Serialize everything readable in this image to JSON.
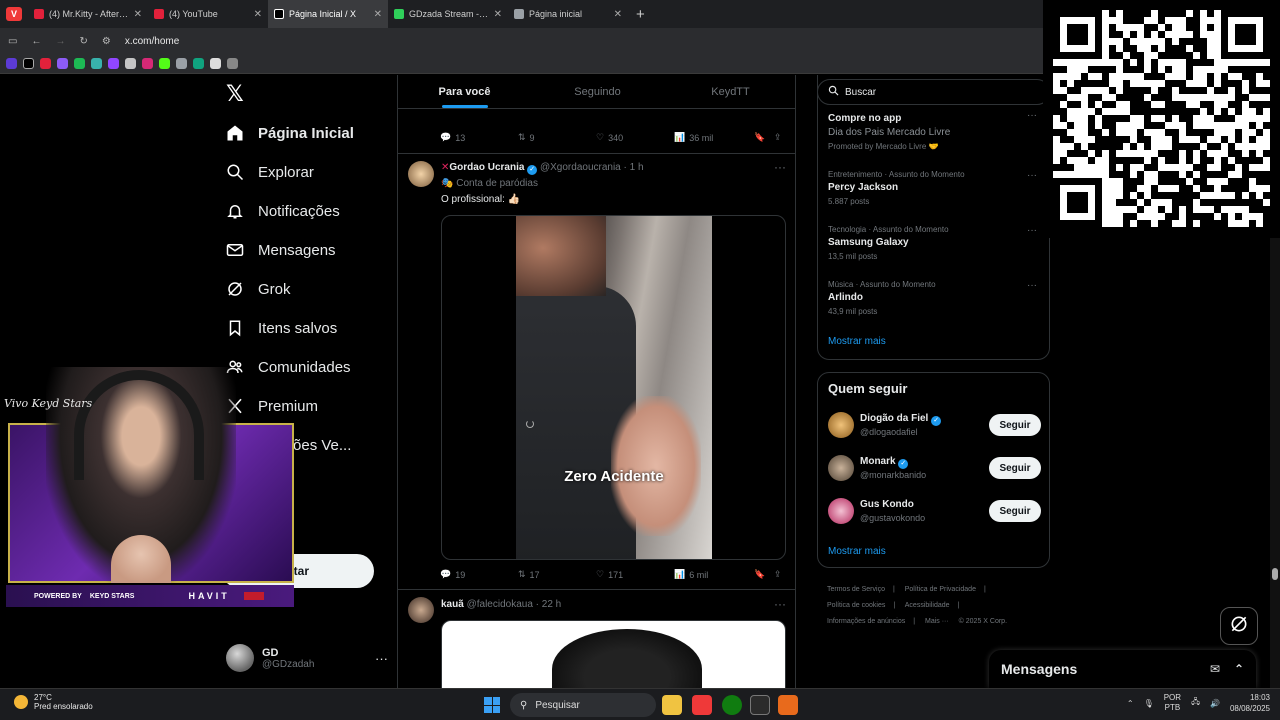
{
  "browser": {
    "tabs": [
      {
        "title": "(4) Mr.Kitty - After Dark",
        "color": "#e2213b"
      },
      {
        "title": "(4) YouTube",
        "color": "#e2213b"
      },
      {
        "title": "Página Inicial / X",
        "color": "#ffffff"
      },
      {
        "title": "GDzada Stream - Watch",
        "color": "#2fcf5a"
      },
      {
        "title": "Página inicial",
        "color": "#9aa0a6"
      }
    ],
    "new_tab_label": "+",
    "url": "x.com/home"
  },
  "x": {
    "nav": [
      {
        "label": "Página Inicial",
        "icon": "home-icon"
      },
      {
        "label": "Explorar",
        "icon": "search-icon"
      },
      {
        "label": "Notificações",
        "icon": "bell-icon"
      },
      {
        "label": "Mensagens",
        "icon": "mail-icon"
      },
      {
        "label": "Grok",
        "icon": "grok-icon"
      },
      {
        "label": "Itens salvos",
        "icon": "bookmark-icon"
      },
      {
        "label": "Comunidades",
        "icon": "people-icon"
      },
      {
        "label": "Premium",
        "icon": "x-icon"
      },
      {
        "label": "nizações Ve...",
        "icon": "lightning-icon"
      }
    ],
    "post_button": "star",
    "account": {
      "name": "GD",
      "handle": "@GDzadah",
      "more": "···"
    },
    "feed_tabs": [
      "Para você",
      "Seguindo",
      "KeydTT"
    ],
    "prev_actions": {
      "replies": "13",
      "reposts": "9",
      "likes": "340",
      "views": "36 mil"
    },
    "tweet1": {
      "name": "Gordao Ucrania",
      "handle": "@Xgordaoucrania",
      "time": "· 1 h",
      "label": "Conta de paródias",
      "text": "O profissional: 👍🏻",
      "video_caption": "Zero Acidente",
      "actions": {
        "replies": "19",
        "reposts": "17",
        "likes": "171",
        "views": "6 mil"
      }
    },
    "tweet2": {
      "name": "kauã",
      "handle": "@falecidokaua",
      "time": "· 22 h"
    },
    "search_placeholder": "Buscar",
    "trends": [
      {
        "meta": "",
        "title": "Compre no app",
        "sub1": "Dia dos Pais Mercado Livre",
        "sub2": "Promoted by Mercado Livre 🤝"
      },
      {
        "meta": "Entretenimento · Assunto do Momento",
        "title": "Percy Jackson",
        "sub1": "5.887 posts"
      },
      {
        "meta": "Tecnologia · Assunto do Momento",
        "title": "Samsung Galaxy",
        "sub1": "13,5 mil posts"
      },
      {
        "meta": "Música · Assunto do Momento",
        "title": "Arlindo",
        "sub1": "43,9 mil posts"
      }
    ],
    "show_more": "Mostrar mais",
    "who_to_follow": {
      "title": "Quem seguir",
      "users": [
        {
          "name": "Diogão da Fiel",
          "handle": "@dlogaodafiel",
          "button": "Seguir"
        },
        {
          "name": "Monark",
          "handle": "@monarkbanido",
          "button": "Seguir"
        },
        {
          "name": "Gus Kondo",
          "handle": "@gustavokondo",
          "button": "Seguir"
        }
      ],
      "show_more": "Mostrar mais"
    },
    "footer": [
      "Termos de Serviço",
      "|",
      "Política de Privacidade",
      "|",
      "Política de cookies",
      "|",
      "Acessibilidade",
      "|",
      "Informações de anúncios",
      "|",
      "Mais ···",
      "© 2025 X Corp."
    ],
    "messages_label": "Mensagens"
  },
  "overlay": {
    "signature": "Vivo Keyd Stars",
    "powered_by": "POWERED BY",
    "sponsor": "KEYD STARS",
    "brand": "HAVIT"
  },
  "taskbar": {
    "weather_temp": "27°C",
    "weather_desc": "Pred ensolarado",
    "search": "Pesquisar",
    "lang1": "POR",
    "lang2": "PTB",
    "time": "18:03",
    "date": "08/08/2025"
  }
}
